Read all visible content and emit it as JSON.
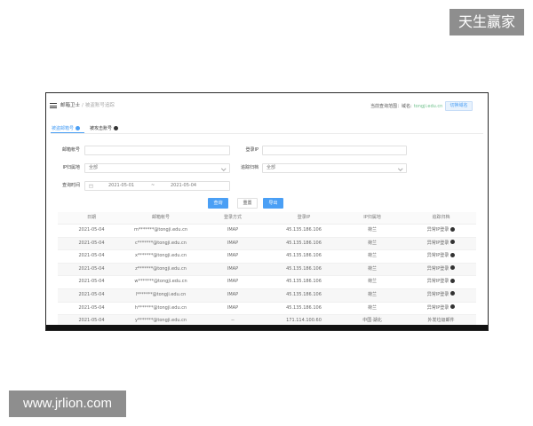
{
  "watermarks": {
    "top_right": "天生赢家",
    "bottom_left": "www.jrlion.com"
  },
  "header": {
    "title": "邮箱卫士",
    "separator": "/",
    "subtitle": "被盗账号追踪",
    "scope_label": "当前查询范围：域名:",
    "scope_value": "tongji.edu.cn",
    "switch_button": "切换域名",
    "menu_icon": "menu-icon"
  },
  "tabs": [
    {
      "label": "被盗邮箱号",
      "icon": "info-icon",
      "active": true
    },
    {
      "label": "被攻击账号",
      "icon": "info-icon",
      "active": false
    }
  ],
  "form": {
    "email": {
      "label": "邮箱帐号",
      "value": ""
    },
    "login_ip": {
      "label": "登录IP",
      "value": ""
    },
    "region": {
      "label": "IP归属地",
      "selected": "全部"
    },
    "archive": {
      "label": "追踪归档",
      "selected": "全部"
    },
    "time": {
      "label": "查询时间",
      "start": "2021-05-01",
      "separator": "~",
      "end": "2021-05-04"
    }
  },
  "actions": {
    "search": "查询",
    "reset": "重置",
    "export": "导出"
  },
  "table": {
    "columns": [
      "日期",
      "邮箱帐号",
      "登录方式",
      "登录IP",
      "IP归属地",
      "追踪归档"
    ],
    "rows": [
      {
        "date": "2021-05-04",
        "email": "m*******@tongji.edu.cn",
        "method": "IMAP",
        "ip": "45.135.186.106",
        "region": "荷兰",
        "archive": "异常IP登录",
        "archive_icon": "question-icon"
      },
      {
        "date": "2021-05-04",
        "email": "c*******@tongji.edu.cn",
        "method": "IMAP",
        "ip": "45.135.186.106",
        "region": "荷兰",
        "archive": "异常IP登录",
        "archive_icon": "question-icon"
      },
      {
        "date": "2021-05-04",
        "email": "x*******@tongji.edu.cn",
        "method": "IMAP",
        "ip": "45.135.186.106",
        "region": "荷兰",
        "archive": "异常IP登录",
        "archive_icon": "question-icon"
      },
      {
        "date": "2021-05-04",
        "email": "z*******@tongji.edu.cn",
        "method": "IMAP",
        "ip": "45.135.186.106",
        "region": "荷兰",
        "archive": "异常IP登录",
        "archive_icon": "question-icon"
      },
      {
        "date": "2021-05-04",
        "email": "w*******@tongji.edu.cn",
        "method": "IMAP",
        "ip": "45.135.186.106",
        "region": "荷兰",
        "archive": "异常IP登录",
        "archive_icon": "question-icon"
      },
      {
        "date": "2021-05-04",
        "email": "l*******@tongji.edu.cn",
        "method": "IMAP",
        "ip": "45.135.186.106",
        "region": "荷兰",
        "archive": "异常IP登录",
        "archive_icon": "question-icon"
      },
      {
        "date": "2021-05-04",
        "email": "h*******@tongji.edu.cn",
        "method": "IMAP",
        "ip": "45.135.186.106",
        "region": "荷兰",
        "archive": "异常IP登录",
        "archive_icon": "question-icon"
      },
      {
        "date": "2021-05-04",
        "email": "y*******@tongji.edu.cn",
        "method": "--",
        "ip": "171.114.100.60",
        "region": "中国·湖北",
        "archive": "外发垃圾邮件",
        "archive_icon": ""
      }
    ]
  },
  "colors": {
    "primary": "#4a9ff5",
    "scope_value": "#6cbf8a",
    "watermark_bg": "#8e8e8e"
  }
}
